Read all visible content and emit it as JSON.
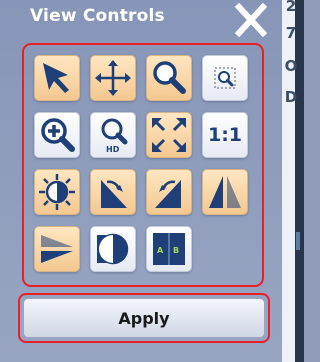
{
  "panel": {
    "title": "View Controls",
    "apply_label": "Apply"
  },
  "background": {
    "letters": [
      "2",
      "7",
      "O",
      "D"
    ]
  },
  "tools": [
    {
      "id": "pointer",
      "icon": "arrow-pointer-icon"
    },
    {
      "id": "pan",
      "icon": "move-arrows-icon"
    },
    {
      "id": "magnify",
      "icon": "magnifier-icon"
    },
    {
      "id": "zoom-box",
      "icon": "zoom-region-icon"
    },
    {
      "id": "zoom-in",
      "icon": "zoom-in-icon"
    },
    {
      "id": "zoom-hd",
      "icon": "zoom-hd-icon",
      "label": "HD"
    },
    {
      "id": "fit",
      "icon": "fit-to-window-icon"
    },
    {
      "id": "actual-size",
      "icon": "actual-size-icon",
      "label": "1:1"
    },
    {
      "id": "brightness",
      "icon": "brightness-icon"
    },
    {
      "id": "rotate-right",
      "icon": "rotate-right-icon"
    },
    {
      "id": "rotate-left",
      "icon": "rotate-left-icon"
    },
    {
      "id": "flip-horizontal",
      "icon": "flip-horizontal-icon"
    },
    {
      "id": "flip-vertical",
      "icon": "flip-vertical-icon"
    },
    {
      "id": "invert",
      "icon": "invert-contrast-icon"
    },
    {
      "id": "compare",
      "icon": "compare-ab-icon",
      "label_a": "A",
      "label_b": "B"
    }
  ],
  "colors": {
    "icon_blue": "#1f3f78",
    "highlight_red": "#e8202a",
    "tool_orange": "#f4c890"
  }
}
